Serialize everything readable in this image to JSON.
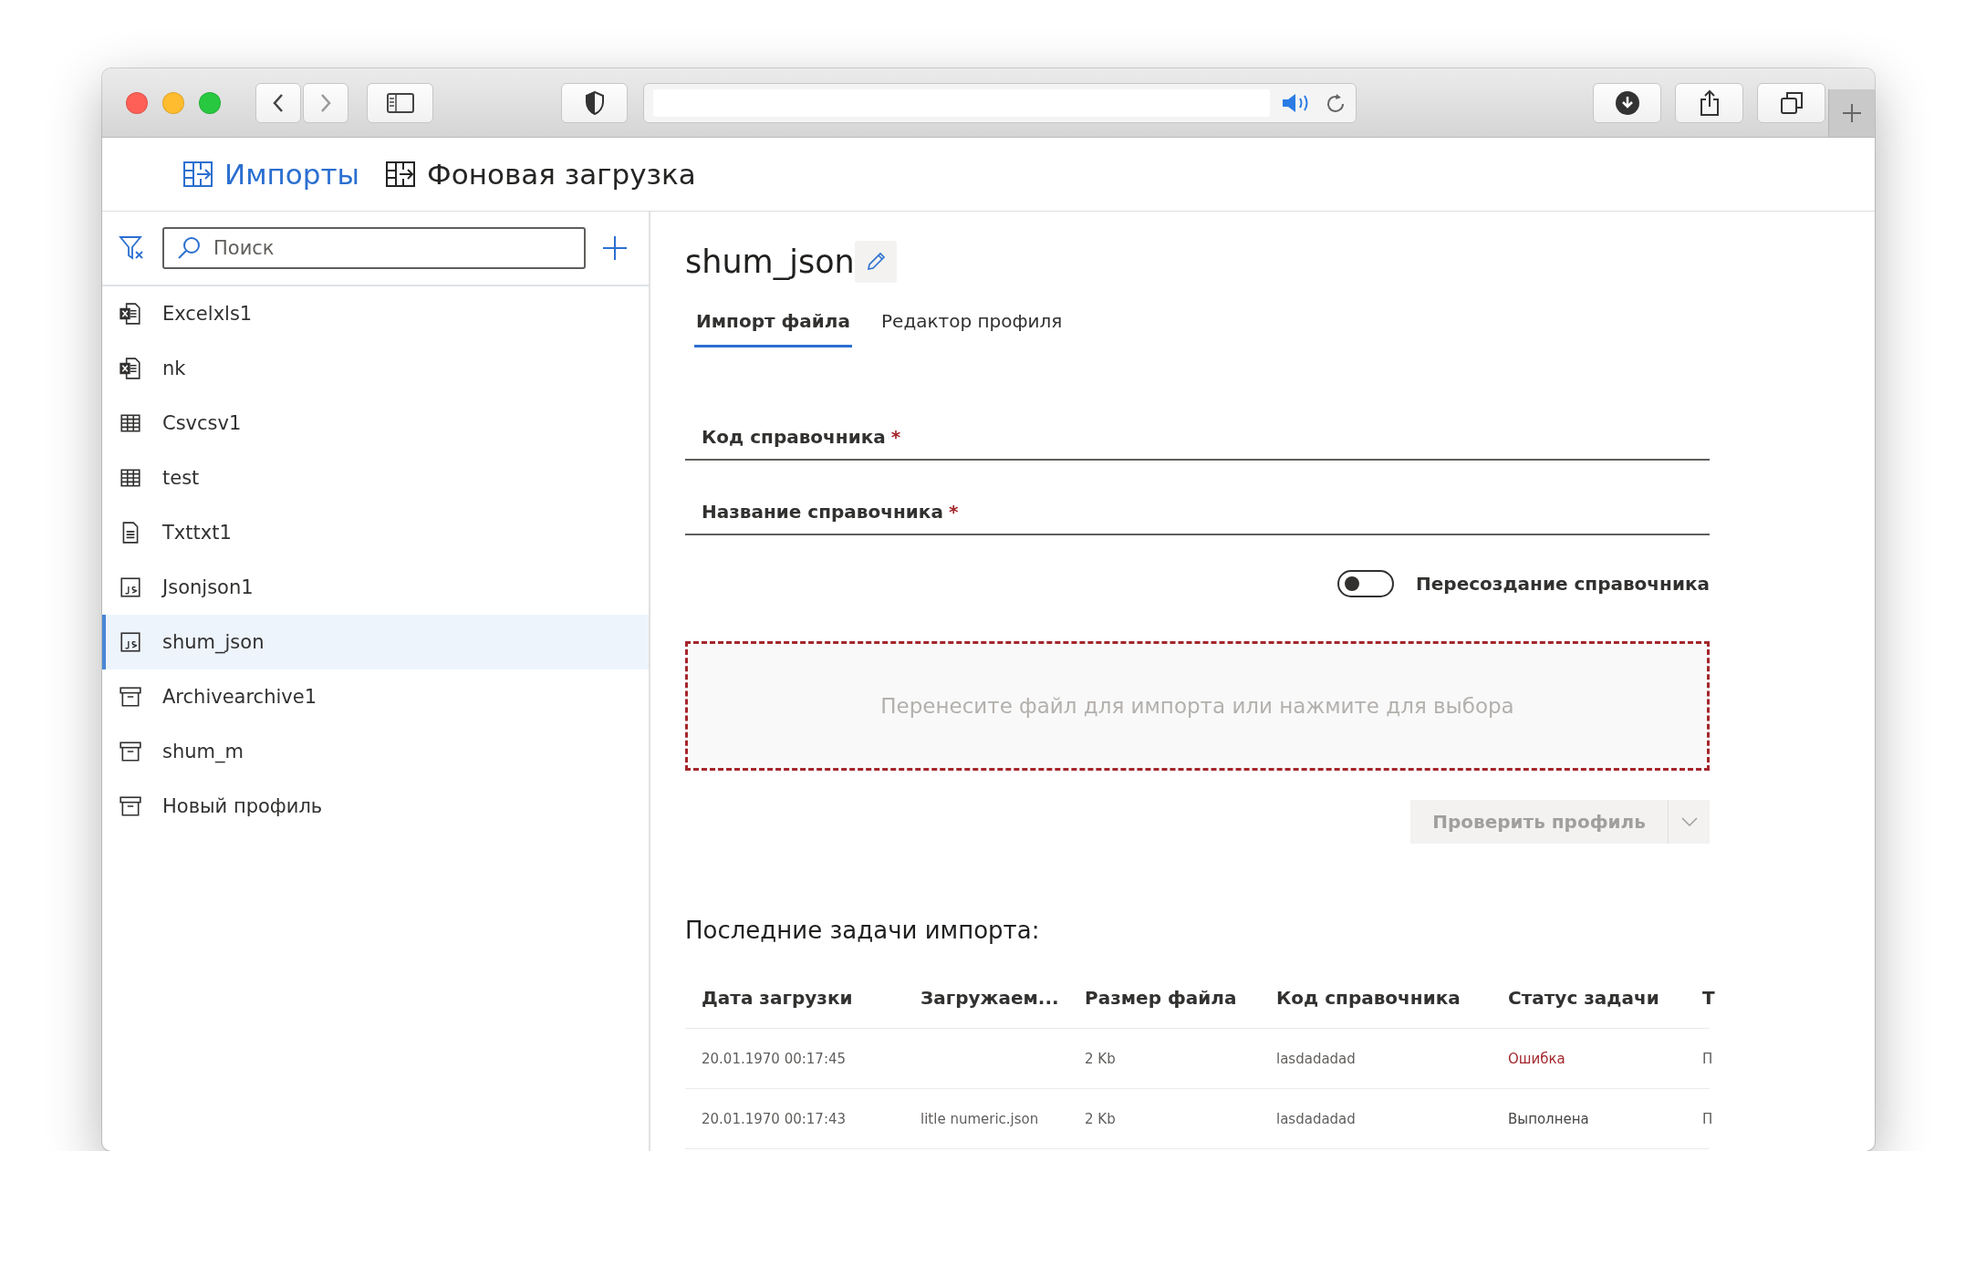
{
  "header_tabs": [
    {
      "label": "Импорты",
      "selected": true
    },
    {
      "label": "Фоновая загрузка",
      "selected": false
    }
  ],
  "sidebar": {
    "search": {
      "placeholder": "Поиск"
    },
    "items": [
      {
        "label": "Excelxls1",
        "kind": "excel",
        "selected": false
      },
      {
        "label": "nk",
        "kind": "excel",
        "selected": false
      },
      {
        "label": "Csvcsv1",
        "kind": "table",
        "selected": false
      },
      {
        "label": "test",
        "kind": "table",
        "selected": false
      },
      {
        "label": "Txttxt1",
        "kind": "text",
        "selected": false
      },
      {
        "label": "Jsonjson1",
        "kind": "json",
        "selected": false
      },
      {
        "label": "shum_json",
        "kind": "json",
        "selected": true
      },
      {
        "label": "Archivearchive1",
        "kind": "archive",
        "selected": false
      },
      {
        "label": "shum_m",
        "kind": "archive",
        "selected": false
      },
      {
        "label": "Новый профиль",
        "kind": "archive",
        "selected": false
      }
    ]
  },
  "main": {
    "title": "shum_json",
    "tabs": [
      {
        "label": "Импорт файла",
        "selected": true
      },
      {
        "label": "Редактор профиля",
        "selected": false
      }
    ],
    "fields": [
      {
        "label": "Код справочника",
        "required_mark": "*"
      },
      {
        "label": "Название справочника",
        "required_mark": "*"
      }
    ],
    "toggle": {
      "label": "Пересоздание справочника",
      "on": false
    },
    "dropzone": {
      "text": "Перенесите файл для импорта или нажмите для выбора"
    },
    "check_button": {
      "label": "Проверить профиль",
      "disabled": true
    },
    "recent": {
      "heading": "Последние задачи импорта:",
      "columns": [
        "Дата загрузки",
        "Загружаем...",
        "Размер файла",
        "Код справочника",
        "Статус задачи",
        "Т"
      ],
      "rows": [
        {
          "date": "20.01.1970 00:17:45",
          "size": "2 Kb",
          "code": "lasdadadad",
          "status": "Ошибка",
          "color": "#a4262c",
          "column_6": "П"
        },
        {
          "date": "20.01.1970 00:17:43",
          "file": "litle numeric.json",
          "size": "2 Kb",
          "code": "lasdadadad",
          "status": "Выполнена",
          "color": "#484644",
          "column_6": "П"
        }
      ]
    }
  }
}
